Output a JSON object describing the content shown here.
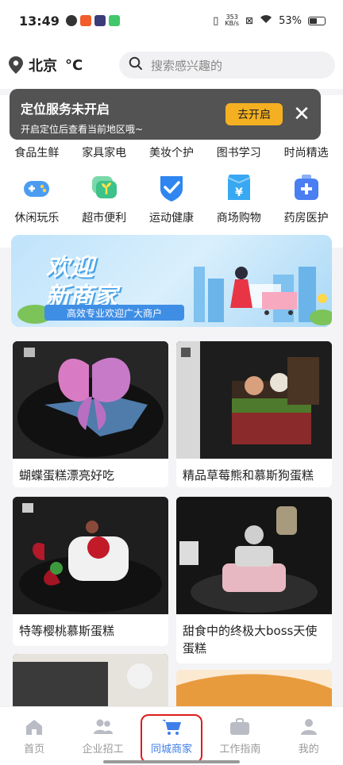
{
  "status": {
    "time": "13:49",
    "net_speed_top": "353",
    "net_speed_unit": "KB/s",
    "battery": "53%",
    "battery_level": 0.53
  },
  "header": {
    "city": "北京",
    "temp_unit": "°C",
    "search_placeholder": "搜索感兴趣的"
  },
  "location_banner": {
    "title": "定位服务未开启",
    "subtitle": "开启定位后查看当前地区哦~",
    "button": "去开启"
  },
  "categories_row1": [
    {
      "label": "食品生鲜"
    },
    {
      "label": "家具家电"
    },
    {
      "label": "美妆个护"
    },
    {
      "label": "图书学习"
    },
    {
      "label": "时尚精选"
    }
  ],
  "categories_row2": [
    {
      "label": "休闲玩乐",
      "icon": "gamepad-icon",
      "color": "#4b9cf0"
    },
    {
      "label": "超市便利",
      "icon": "sprout-chat-icon",
      "color": "#3cc28a"
    },
    {
      "label": "运动健康",
      "icon": "shield-check-icon",
      "color": "#2f86f0"
    },
    {
      "label": "商场购物",
      "icon": "yen-bag-icon",
      "color": "#38a8f2"
    },
    {
      "label": "药房医护",
      "icon": "medkit-icon",
      "color": "#4a7ef2"
    }
  ],
  "promo": {
    "line1": "欢迎",
    "line2": "新商家",
    "tagline": "高效专业欢迎广大商户"
  },
  "products": [
    {
      "name": "蝴蝶蛋糕漂亮好吃"
    },
    {
      "name": "精品草莓熊和慕斯狗蛋糕"
    },
    {
      "name": "特等樱桃慕斯蛋糕"
    },
    {
      "name": "甜食中的终极大boss天使蛋糕"
    }
  ],
  "nav": [
    {
      "label": "首页",
      "icon": "home-icon"
    },
    {
      "label": "企业招工",
      "icon": "people-icon"
    },
    {
      "label": "同城商家",
      "icon": "cart-icon",
      "active": true
    },
    {
      "label": "工作指南",
      "icon": "briefcase-icon"
    },
    {
      "label": "我的",
      "icon": "user-icon"
    }
  ],
  "colors": {
    "accent": "#3f7ee8",
    "highlight": "#e01c1c",
    "banner_button": "#f5b021"
  }
}
